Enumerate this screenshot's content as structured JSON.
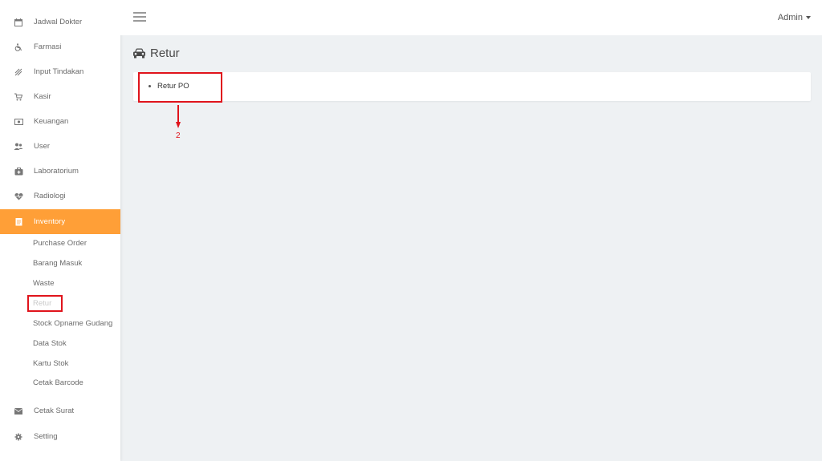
{
  "sidebar": {
    "items": [
      {
        "label": "Jadwal Dokter",
        "icon": "calendar-icon"
      },
      {
        "label": "Farmasi",
        "icon": "wheelchair-icon"
      },
      {
        "label": "Input Tindakan",
        "icon": "percent-icon"
      },
      {
        "label": "Kasir",
        "icon": "cart-icon"
      },
      {
        "label": "Keuangan",
        "icon": "money-icon"
      },
      {
        "label": "User",
        "icon": "users-icon"
      },
      {
        "label": "Laboratorium",
        "icon": "medkit-icon"
      },
      {
        "label": "Radiologi",
        "icon": "heartbeat-icon"
      },
      {
        "label": "Inventory",
        "icon": "clipboard-icon",
        "active": true
      },
      {
        "label": "Cetak Surat",
        "icon": "envelope-icon"
      },
      {
        "label": "Setting",
        "icon": "gear-icon"
      }
    ],
    "inventory_submenu": [
      {
        "label": "Purchase Order"
      },
      {
        "label": "Barang Masuk"
      },
      {
        "label": "Waste"
      },
      {
        "label": "Retur"
      },
      {
        "label": "Stock Opname Gudang"
      },
      {
        "label": "Data Stok"
      },
      {
        "label": "Kartu Stok"
      },
      {
        "label": "Cetak Barcode"
      }
    ]
  },
  "topbar": {
    "menu_icon": "hamburger-icon",
    "user_label": "Admin"
  },
  "main": {
    "title": "Retur",
    "title_icon": "car-icon",
    "links": [
      {
        "label": "Retur PO"
      }
    ]
  },
  "annotations": {
    "step_number": "2",
    "color": "#e0141c"
  },
  "colors": {
    "accent": "#ff9f37",
    "background": "#eef1f3"
  }
}
